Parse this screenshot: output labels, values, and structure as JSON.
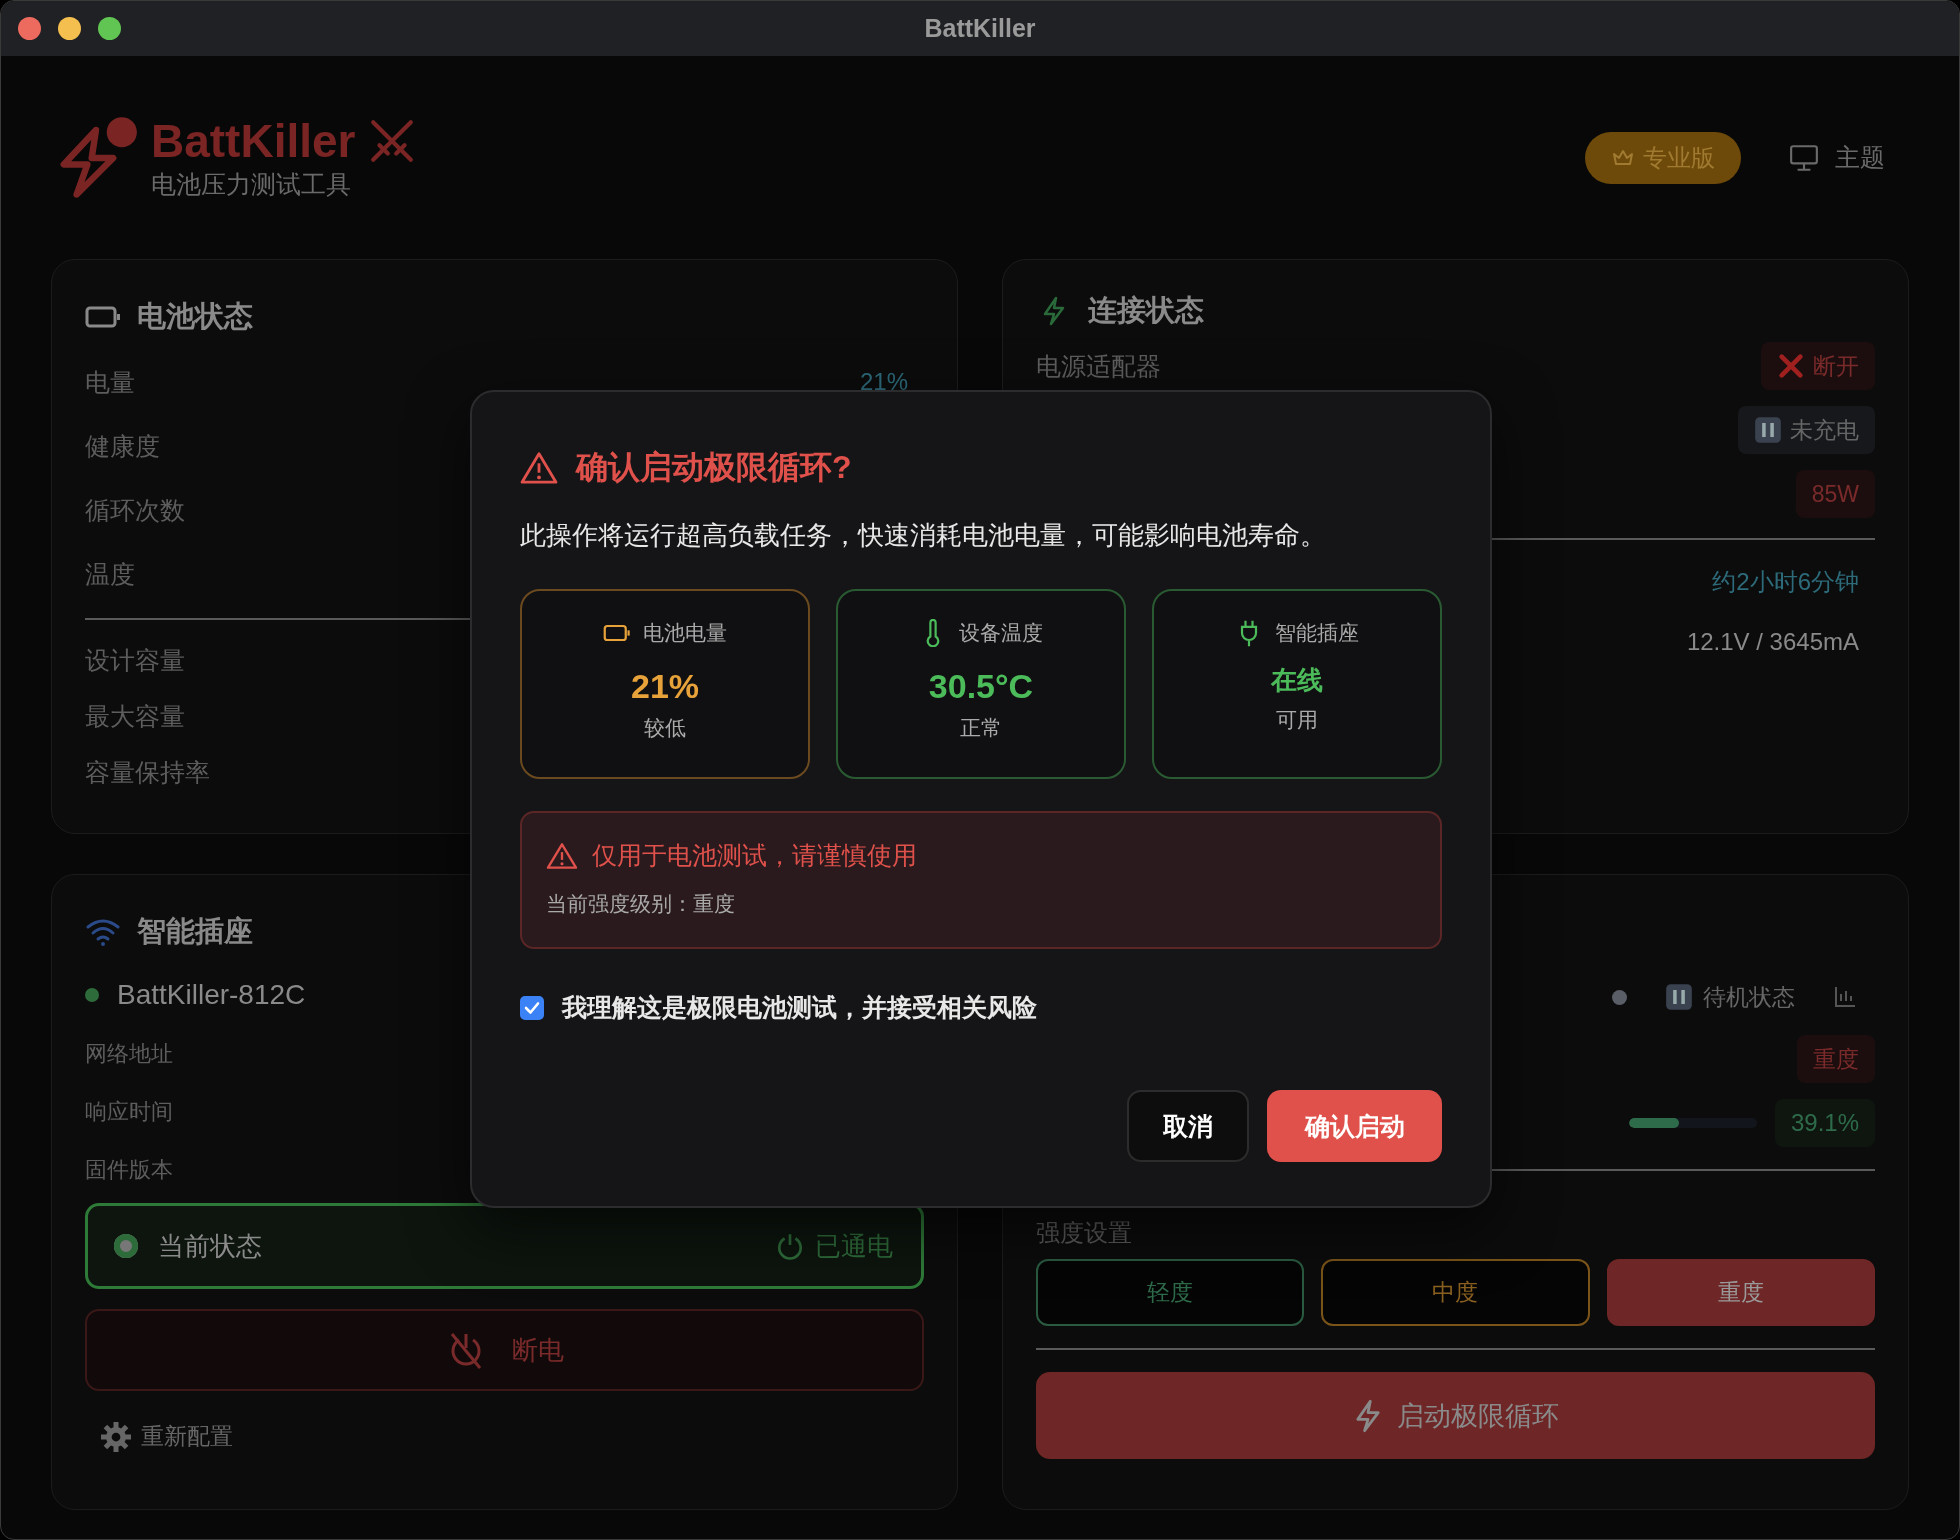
{
  "window": {
    "title": "BattKiller"
  },
  "header": {
    "app_name": "BattKiller",
    "subtitle": "电池压力测试工具",
    "pro_badge": "专业版",
    "theme_button": "主题"
  },
  "battery_card": {
    "title": "电池状态",
    "rows": [
      {
        "label": "电量",
        "value": "21%"
      },
      {
        "label": "健康度"
      },
      {
        "label": "循环次数"
      },
      {
        "label": "温度"
      }
    ],
    "capacity_rows": [
      "设计容量",
      "最大容量",
      "容量保持率"
    ]
  },
  "connection_card": {
    "title": "连接状态",
    "rows": [
      {
        "label": "电源适配器",
        "value": "断开",
        "kind": "disconnected"
      },
      {
        "value": "未充电",
        "kind": "paused"
      },
      {
        "value": "85W",
        "kind": "power"
      }
    ],
    "info_rows": [
      {
        "value": "约2小时6分钟",
        "kind": "time"
      },
      {
        "value": "12.1V / 3645mA",
        "kind": "plain"
      }
    ]
  },
  "plug_card": {
    "title": "智能插座",
    "device": {
      "name": "BattKiller-812C",
      "online": true
    },
    "rows": [
      "网络地址",
      "响应时间",
      "固件版本"
    ],
    "current_state": {
      "label": "当前状态",
      "value": "已通电",
      "powered": true
    },
    "power_off_button": "断电",
    "reconfigure_link": "重新配置"
  },
  "test_card": {
    "status": "待机状态",
    "intensity_badge": "重度",
    "progress": {
      "level": 0.391,
      "reading": "39.1%"
    },
    "intensity_label": "强度设置",
    "intensity_options": [
      {
        "label": "轻度",
        "kind": "light",
        "selected": false
      },
      {
        "label": "中度",
        "kind": "medium",
        "selected": false
      },
      {
        "label": "重度",
        "kind": "heavy",
        "selected": true
      }
    ],
    "start_button": "启动极限循环"
  },
  "dialog": {
    "title": "确认启动极限循环?",
    "message": "此操作将运行超高负载任务，快速消耗电池电量，可能影响电池寿命。",
    "stats": [
      {
        "kind": "battery",
        "label": "电池电量",
        "value": "21%",
        "note": "较低"
      },
      {
        "kind": "temperature",
        "label": "设备温度",
        "value": "30.5°C",
        "note": "正常"
      },
      {
        "kind": "plug",
        "label": "智能插座",
        "value": "在线",
        "note": "可用"
      }
    ],
    "warning": {
      "title": "仅用于电池测试，请谨慎使用",
      "detail": "当前强度级别：重度"
    },
    "consent": {
      "label": "我理解这是极限电池测试，并接受相关风险",
      "checked": true
    },
    "buttons": {
      "cancel": "取消",
      "confirm": "确认启动"
    }
  }
}
